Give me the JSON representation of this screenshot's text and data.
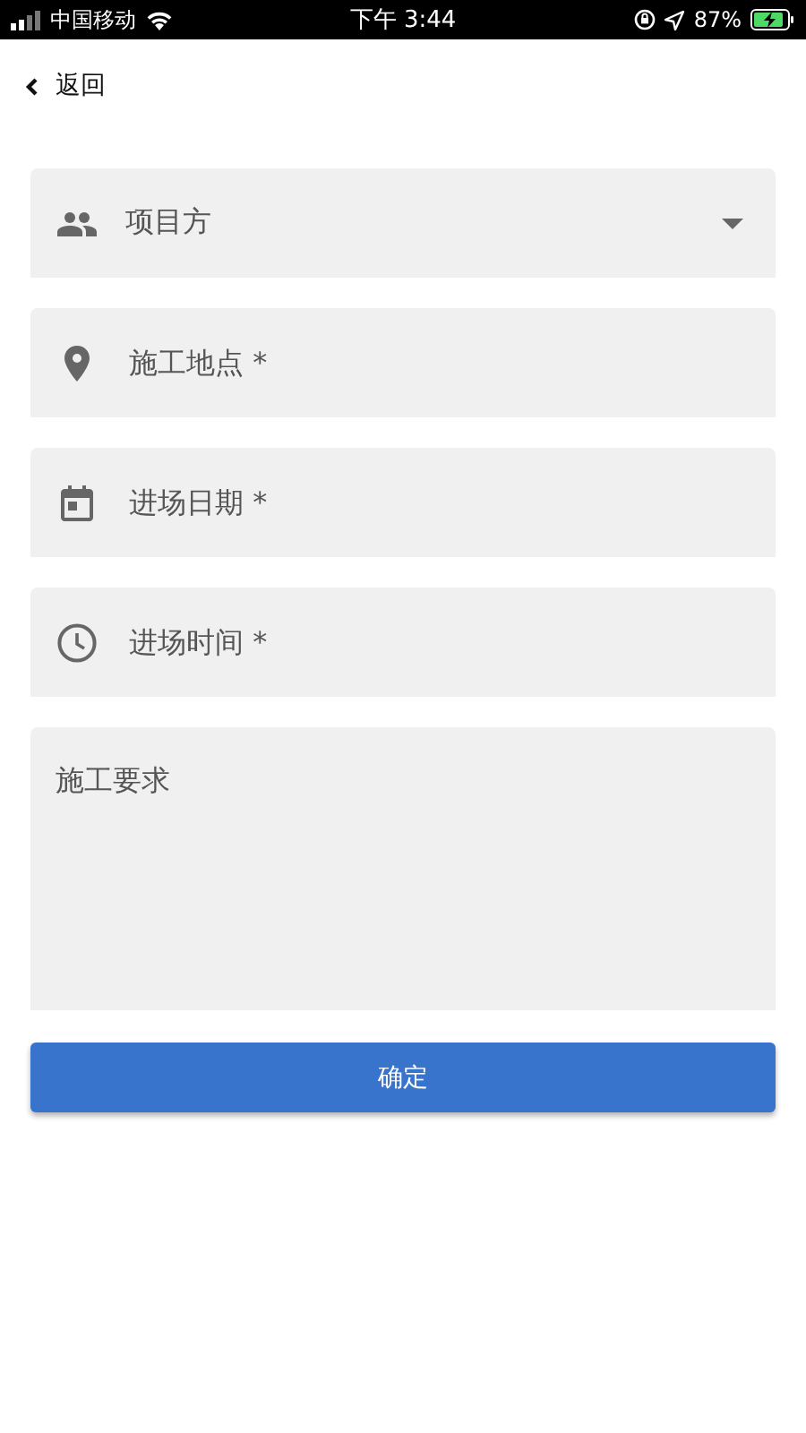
{
  "status_bar": {
    "carrier": "中国移动",
    "time": "下午 3:44",
    "battery": "87%"
  },
  "back": {
    "label": "返回"
  },
  "fields": [
    {
      "kind": "select",
      "placeholder": "项目方"
    },
    {
      "kind": "text",
      "placeholder": "施工地点 *"
    },
    {
      "kind": "text",
      "placeholder": "进场日期 *"
    },
    {
      "kind": "text",
      "placeholder": "进场时间 *"
    },
    {
      "kind": "textarea",
      "placeholder": "施工要求"
    }
  ],
  "submit": {
    "label": "确定"
  }
}
